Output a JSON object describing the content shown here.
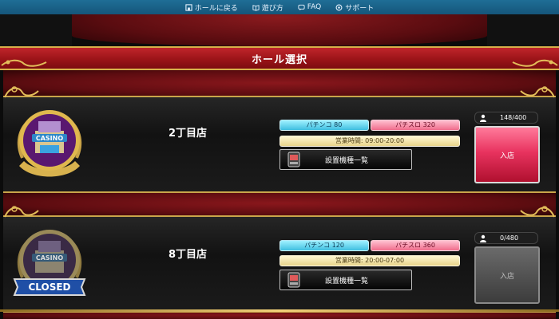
{
  "nav": {
    "items": [
      {
        "label": "ホールに戻る",
        "icon": "home-icon"
      },
      {
        "label": "遊び方",
        "icon": "book-icon"
      },
      {
        "label": "FAQ",
        "icon": "chat-icon"
      },
      {
        "label": "サポート",
        "icon": "support-icon"
      }
    ]
  },
  "header": {
    "title": "ホール選択"
  },
  "colors": {
    "accent_gold": "#d7b04a",
    "banner_red": "#b01a20",
    "enter_pink": "#e8335f"
  },
  "rooms": [
    {
      "name": "2丁目店",
      "badge_label": "CASINO",
      "badge_status": "",
      "pachinko": "パチンコ 80",
      "pachislot": "パチスロ 320",
      "hours": "営業時間: 09:00-20:00",
      "machine_list": "設置機種一覧",
      "occupancy": "148/400",
      "enter": "入店",
      "enter_enabled": true
    },
    {
      "name": "8丁目店",
      "badge_label": "CASINO",
      "badge_status": "CLOSED",
      "pachinko": "パチンコ 120",
      "pachislot": "パチスロ 360",
      "hours": "営業時間: 20:00-07:00",
      "machine_list": "設置機種一覧",
      "occupancy": "0/480",
      "enter": "入店",
      "enter_enabled": false
    }
  ]
}
